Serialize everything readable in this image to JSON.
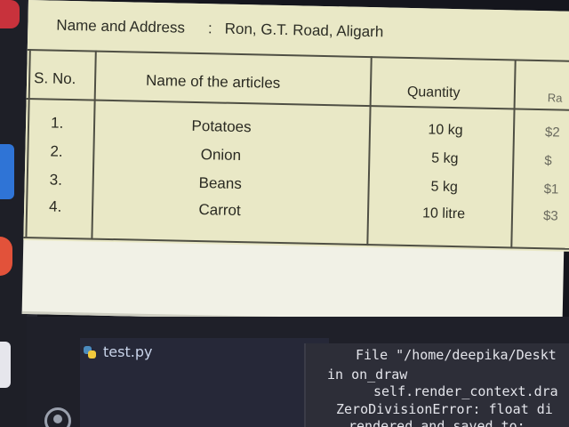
{
  "document": {
    "header": {
      "label": "Name and Address",
      "separator": ":",
      "value": "Ron, G.T. Road, Aligarh"
    },
    "table": {
      "columns": [
        "S. No.",
        "Name of the articles",
        "Quantity",
        "Ra"
      ],
      "rows": [
        {
          "sno": "1.",
          "article": "Potatoes",
          "quantity": "10 kg",
          "rate": "$2"
        },
        {
          "sno": "2.",
          "article": "Onion",
          "quantity": "5 kg",
          "rate": "$"
        },
        {
          "sno": "3.",
          "article": "Beans",
          "quantity": "5 kg",
          "rate": "$1"
        },
        {
          "sno": "4.",
          "article": "Carrot",
          "quantity": "10 litre",
          "rate": "$3"
        }
      ]
    }
  },
  "file_browser": {
    "items": [
      {
        "name": "test.py",
        "icon": "python-file-icon"
      }
    ]
  },
  "terminal": {
    "lines": [
      "File \"/home/deepika/Deskt",
      "in on_draw",
      "self.render_context.dra",
      "ZeroDivisionError: float di",
      "rendered and saved to:"
    ]
  },
  "colors": {
    "page": "#e9e8c6",
    "ink": "#2a2a22",
    "terminal_bg": "#2d2e38",
    "dock_bg": "#1e1f27"
  }
}
